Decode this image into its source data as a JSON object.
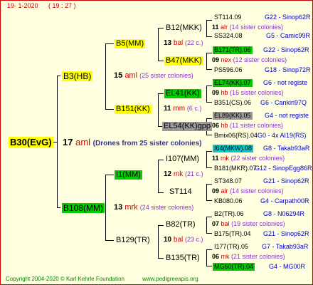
{
  "header": {
    "date": "19-  1-2020",
    "time": "( 19 : 27 )"
  },
  "footer": {
    "copyright": "Copyright 2004-2020 © Karl Kehrle Foundation",
    "site": "www.pedigreeapis.org"
  },
  "root": {
    "label": "B30(EvG)",
    "count": "17",
    "code": "aml",
    "note": "(Drones from 25 sister colonies)"
  },
  "gen1": [
    {
      "label": "B3(HB)",
      "count": "15",
      "code": "aml",
      "note": "(25 sister colonies)"
    },
    {
      "label": "B108(MM)",
      "count": "13",
      "code": "mrk",
      "note": "(24 sister colonies)"
    }
  ],
  "gen2": [
    {
      "label": "B5(MM)",
      "count": "13",
      "code": "bal",
      "note": "(22 c.)"
    },
    {
      "label": "B151(KK)",
      "count": "11",
      "code": "mm",
      "note": "(6 c.)"
    },
    {
      "label": "I1(MM)",
      "count": "12",
      "code": "mk",
      "note": "(21 c.)"
    },
    {
      "label": "B129(TR)",
      "count": "10",
      "code": "bal",
      "note": "(23 c.)"
    }
  ],
  "gen3": [
    {
      "label": "B12(MKK)",
      "count": "11",
      "code": "alr",
      "note": "(14 sister colonies)"
    },
    {
      "label": "B47(MKK)",
      "count": "09",
      "code": "nex",
      "note": "(12 sister colonies)"
    },
    {
      "label": "EL41(KK)",
      "count": "09",
      "code": "hb",
      "note": "(16 sister colonies)"
    },
    {
      "label": "EL54(KK)gpp",
      "count": "06",
      "code": "hb",
      "note": "(11 sister colonies)"
    },
    {
      "label": "I107(MM)",
      "count": "11",
      "code": "mk",
      "note": "(22 sister colonies)"
    },
    {
      "label": "ST114",
      "count": "09",
      "code": "alr",
      "note": "(14 sister colonies)"
    },
    {
      "label": "B82(TR)",
      "count": "07",
      "code": "bal",
      "note": "(19 sister colonies)"
    },
    {
      "label": "B135(TR)",
      "count": "06",
      "code": "mk",
      "note": "(21 sister colonies)"
    }
  ],
  "gen4": [
    {
      "label": "ST114.09",
      "ref": "G22 - Sinop62R"
    },
    {
      "label": "SS324.08",
      "ref": "G5 - Camic99R"
    },
    {
      "label": "B171(TR).06",
      "ref": "G22 - Sinop62R"
    },
    {
      "label": "PS596.06",
      "ref": "G18 - Sinop72R"
    },
    {
      "label": "EL74(KK).07",
      "ref": "G6 - not registe"
    },
    {
      "label": "B351(CS).06",
      "ref": "G6 - Cankiri97Q"
    },
    {
      "label": "EL89(KK).05",
      "ref": "G4 - not registe"
    },
    {
      "label": "Bmix06(RS).04",
      "ref": "G0 - 4x AI19(RS)"
    },
    {
      "label": "I64(MKW).08",
      "ref": "G8 - Takab93aR"
    },
    {
      "label": "B181(MKR).07",
      "ref": "G12 - SinopEgg86R"
    },
    {
      "label": "ST348.07",
      "ref": "G21 - Sinop62R"
    },
    {
      "label": "KB080.06",
      "ref": "G4 - Carpath00R"
    },
    {
      "label": "B2(TR).06",
      "ref": "G8 - N06294R"
    },
    {
      "label": "B175(TR).04",
      "ref": "G21 - Sinop62R"
    },
    {
      "label": "I177(TR).05",
      "ref": "G7 - Takab93aR"
    },
    {
      "label": "MG60(TR).04",
      "ref": "G4 - MG00R"
    }
  ]
}
